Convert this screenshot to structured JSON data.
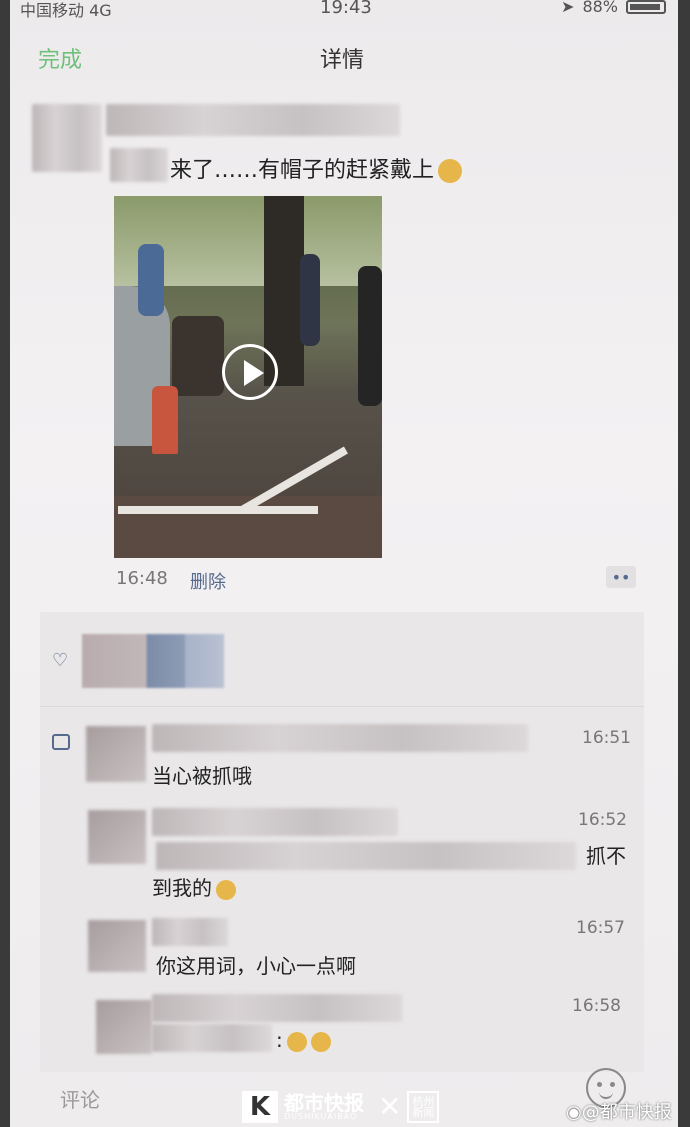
{
  "status_bar": {
    "carrier": "中国移动",
    "network": "4G",
    "time": "19:43",
    "battery": "88%"
  },
  "nav": {
    "done_label": "完成",
    "title": "详情"
  },
  "post": {
    "text": "来了……有帽子的赶紧戴上",
    "time": "16:48",
    "delete_label": "删除",
    "more_label": "••"
  },
  "comments": [
    {
      "time": "16:51",
      "text": "当心被抓哦"
    },
    {
      "time": "16:52",
      "text_tail": "抓不",
      "text_line2": "到我的"
    },
    {
      "time": "16:57",
      "text": "你这用词，小心一点啊"
    },
    {
      "time": "16:58",
      "text": ":"
    }
  ],
  "footer": {
    "comment_placeholder": "评论"
  },
  "watermark": {
    "brand_cn": "都市快报",
    "brand_en": "DUSHIKUAIBAO",
    "partner": "杭州新闻",
    "weibo": "@都市快报"
  },
  "colors": {
    "accent_green": "#6fc07a",
    "link_blue": "#556a8e"
  }
}
